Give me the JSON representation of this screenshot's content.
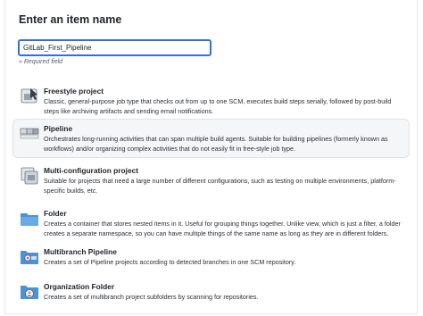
{
  "heading": "Enter an item name",
  "name_input": {
    "value": "GitLab_First_Pipeline",
    "placeholder": ""
  },
  "required_note": "» Required field",
  "items": [
    {
      "title": "Freestyle project",
      "description": "Classic, general-purpose job type that checks out from up to one SCM, executes build steps serially, followed by post-build steps like archiving artifacts and sending email notifications.",
      "icon": "freestyle-icon"
    },
    {
      "title": "Pipeline",
      "description": "Orchestrates long-running activities that can span multiple build agents. Suitable for building pipelines (formerly known as workflows) and/or organizing complex activities that do not easily fit in free-style job type.",
      "icon": "pipeline-icon"
    },
    {
      "title": "Multi-configuration project",
      "description": "Suitable for projects that need a large number of different configurations, such as testing on multiple environments, platform-specific builds, etc.",
      "icon": "multi-configuration-icon"
    },
    {
      "title": "Folder",
      "description": "Creates a container that stores nested items in it. Useful for grouping things together. Unlike view, which is just a filter, a folder creates a separate namespace, so you can have multiple things of the same name as long as they are in different folders.",
      "icon": "folder-icon"
    },
    {
      "title": "Multibranch Pipeline",
      "description": "Creates a set of Pipeline projects according to detected branches in one SCM repository.",
      "icon": "multibranch-pipeline-icon"
    },
    {
      "title": "Organization Folder",
      "description": "Creates a set of multibranch project subfolders by scanning for repositories.",
      "icon": "organization-folder-icon"
    }
  ],
  "selected_item": "Pipeline",
  "colors": {
    "accent": "#2f6fe0",
    "folder": "#4a93d8",
    "selected_bg": "#f5f6f8"
  }
}
